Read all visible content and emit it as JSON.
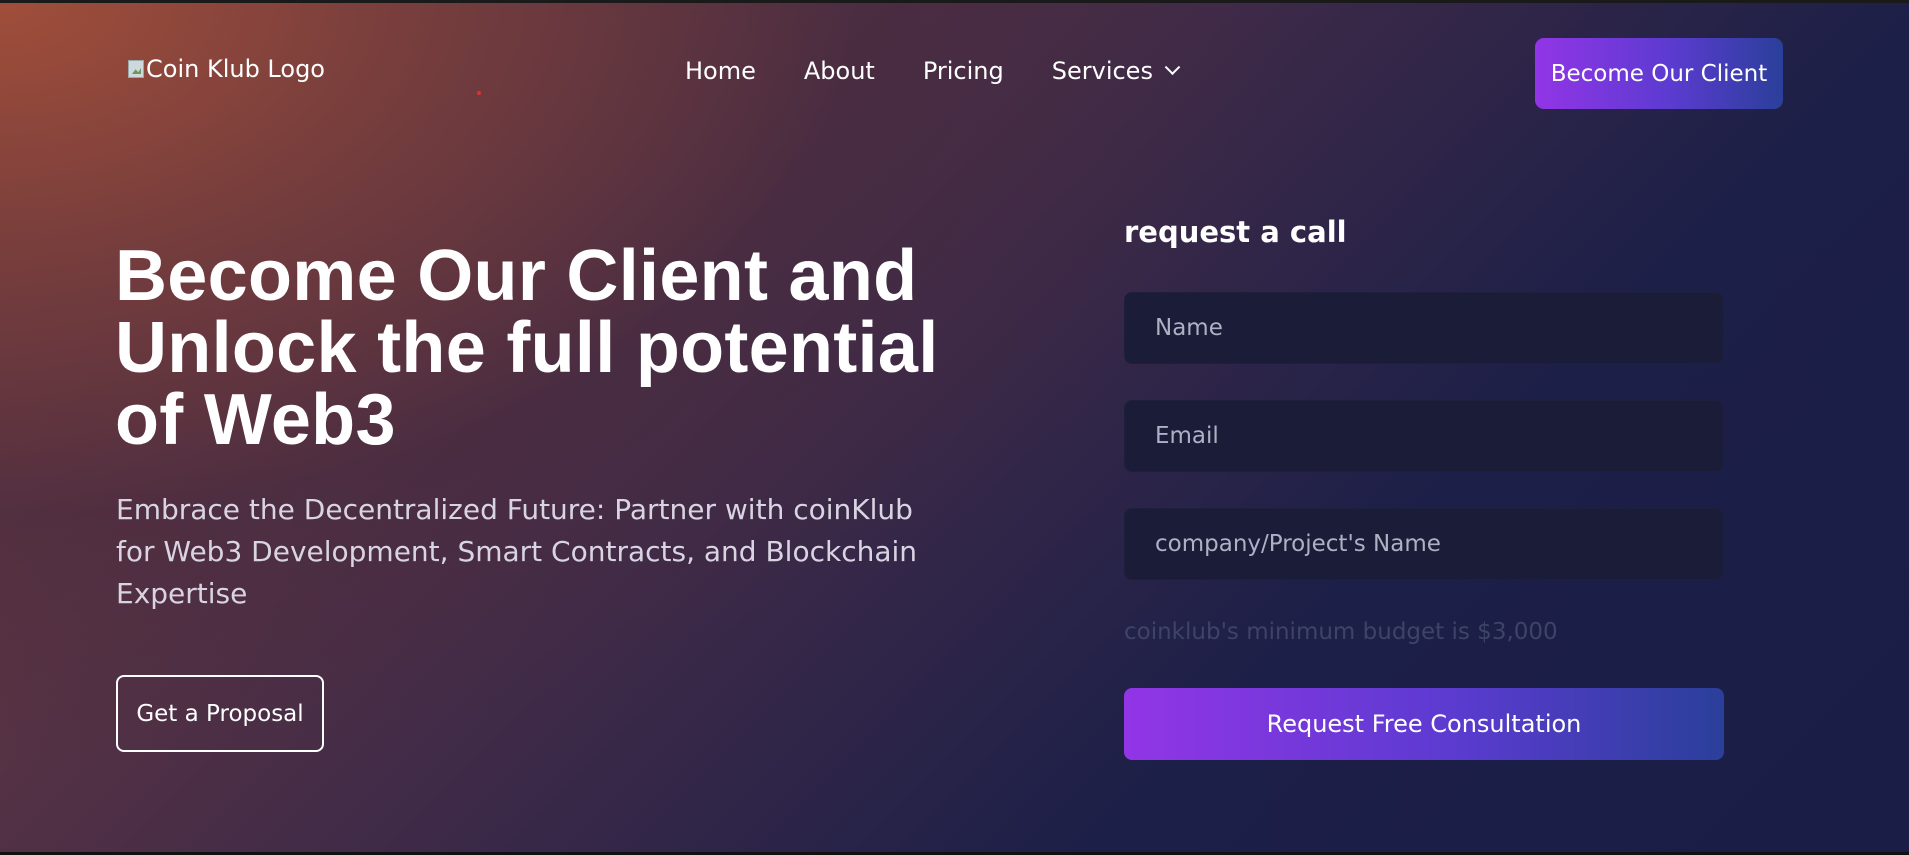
{
  "header": {
    "logo_alt": "Coin Klub Logo",
    "nav": [
      {
        "label": "Home"
      },
      {
        "label": "About"
      },
      {
        "label": "Pricing"
      },
      {
        "label": "Services"
      }
    ],
    "cta_label": "Become Our Client"
  },
  "hero": {
    "title": "Become Our Client and Unlock the full potential of Web3",
    "subtitle": "Embrace the Decentralized Future: Partner with coinKlub for Web3 Development, Smart Contracts, and Blockchain Expertise",
    "proposal_label": "Get a Proposal"
  },
  "form": {
    "title": "request a call",
    "name_placeholder": "Name",
    "email_placeholder": "Email",
    "company_placeholder": "company/Project's Name",
    "budget_note": "coinklub's minimum budget is $3,000",
    "submit_label": "Request Free Consultation"
  },
  "colors": {
    "accent_start": "#9235e6",
    "accent_end": "#2a3f9a",
    "background_dark": "#1a1d46",
    "background_warm": "#a04e3a"
  },
  "icons": {
    "services_dropdown": "chevron-down-icon",
    "logo": "broken-image-icon"
  }
}
